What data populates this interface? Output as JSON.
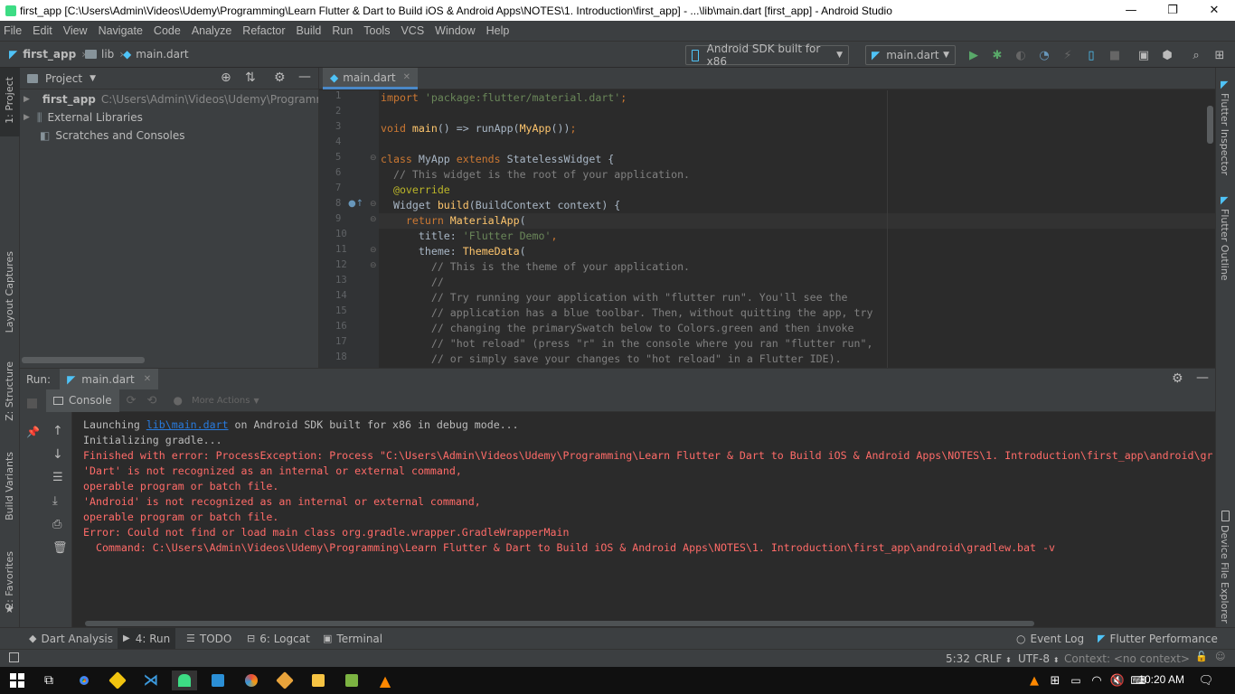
{
  "window": {
    "title": "first_app [C:\\Users\\Admin\\Videos\\Udemy\\Programming\\Learn Flutter & Dart to Build iOS & Android Apps\\NOTES\\1. Introduction\\first_app] - ...\\lib\\main.dart [first_app] - Android Studio",
    "minimize": "—",
    "maximize": "❐",
    "close": "✕"
  },
  "menu": [
    "File",
    "Edit",
    "View",
    "Navigate",
    "Code",
    "Analyze",
    "Refactor",
    "Build",
    "Run",
    "Tools",
    "VCS",
    "Window",
    "Help"
  ],
  "breadcrumb": [
    "first_app",
    "lib",
    "main.dart"
  ],
  "toolbar": {
    "device": "Android SDK built for x86",
    "run_config": "main.dart"
  },
  "left_strip": {
    "project": "1: Project",
    "layout_captures": "Layout Captures",
    "structure": "Z: Structure",
    "build_variants": "Build Variants",
    "favorites": "2: Favorites"
  },
  "right_strip": {
    "flutter_inspector": "Flutter Inspector",
    "flutter_outline": "Flutter Outline",
    "device_file_explorer": "Device File Explorer"
  },
  "project_pane": {
    "title": "Project",
    "items": [
      {
        "label": "first_app",
        "path": "C:\\Users\\Admin\\Videos\\Udemy\\Programmin"
      },
      {
        "label": "External Libraries",
        "path": ""
      },
      {
        "label": "Scratches and Consoles",
        "path": ""
      }
    ]
  },
  "editor": {
    "tab": "main.dart",
    "line_numbers": [
      "1",
      "2",
      "3",
      "4",
      "5",
      "6",
      "7",
      "8",
      "9",
      "10",
      "11",
      "12",
      "13",
      "14",
      "15",
      "16",
      "17",
      "18"
    ]
  },
  "run_panel": {
    "label": "Run:",
    "tab": "main.dart",
    "console_tab": "Console",
    "more_actions": "More Actions",
    "console_lines": [
      {
        "pre": "Launching ",
        "link": "lib\\main.dart",
        "post": " on Android SDK built for x86 in debug mode...",
        "kind": "norm"
      },
      {
        "text": "Initializing gradle...",
        "kind": "norm"
      },
      {
        "text": "Finished with error: ProcessException: Process \"C:\\Users\\Admin\\Videos\\Udemy\\Programming\\Learn Flutter & Dart to Build iOS & Android Apps\\NOTES\\1. Introduction\\first_app\\android\\gr",
        "kind": "err"
      },
      {
        "text": "'Dart' is not recognized as an internal or external command,",
        "kind": "err"
      },
      {
        "text": "operable program or batch file.",
        "kind": "err"
      },
      {
        "text": "'Android' is not recognized as an internal or external command,",
        "kind": "err"
      },
      {
        "text": "operable program or batch file.",
        "kind": "err"
      },
      {
        "text": "Error: Could not find or load main class org.gradle.wrapper.GradleWrapperMain",
        "kind": "err"
      },
      {
        "text": "  Command: C:\\Users\\Admin\\Videos\\Udemy\\Programming\\Learn Flutter & Dart to Build iOS & Android Apps\\NOTES\\1. Introduction\\first_app\\android\\gradlew.bat -v",
        "kind": "err"
      }
    ]
  },
  "bottom_tabs": {
    "dart_analysis": "Dart Analysis",
    "run": "4: Run",
    "todo": "TODO",
    "logcat": "6: Logcat",
    "terminal": "Terminal",
    "event_log": "Event Log",
    "flutter_performance": "Flutter Performance"
  },
  "status_bar": {
    "position": "5:32",
    "line_sep": "CRLF",
    "encoding": "UTF-8",
    "context": "Context: <no context>"
  },
  "taskbar": {
    "time": "10:20 AM"
  },
  "colors": {
    "keyword": "#cc7832",
    "string": "#6a8759",
    "comment": "#808080",
    "function": "#ffc66d",
    "error": "#ff6b68",
    "accent": "#4a88c7"
  }
}
